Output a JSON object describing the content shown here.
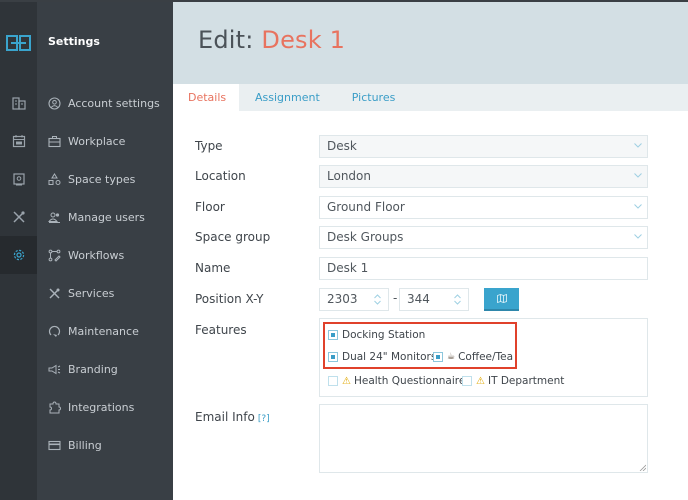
{
  "sidebar": {
    "title": "Settings",
    "logo_icon": "app-logo-icon",
    "rail": [
      {
        "icon": "building-icon",
        "active": false
      },
      {
        "icon": "calendar-icon",
        "active": false
      },
      {
        "icon": "badge-icon",
        "active": false
      },
      {
        "icon": "tools-icon",
        "active": false
      },
      {
        "icon": "gear-icon",
        "active": true
      }
    ],
    "items": [
      {
        "label": "Account settings",
        "icon": "user-circle-icon"
      },
      {
        "label": "Workplace",
        "icon": "briefcase-icon"
      },
      {
        "label": "Space types",
        "icon": "shapes-icon"
      },
      {
        "label": "Manage users",
        "icon": "users-icon"
      },
      {
        "label": "Workflows",
        "icon": "workflow-icon"
      },
      {
        "label": "Services",
        "icon": "tools-icon"
      },
      {
        "label": "Maintenance",
        "icon": "maintenance-icon"
      },
      {
        "label": "Branding",
        "icon": "megaphone-icon"
      },
      {
        "label": "Integrations",
        "icon": "puzzle-icon"
      },
      {
        "label": "Billing",
        "icon": "credit-card-icon"
      }
    ]
  },
  "header": {
    "prefix": "Edit:",
    "name": "Desk 1"
  },
  "tabs": [
    {
      "label": "Details",
      "active": true
    },
    {
      "label": "Assignment",
      "active": false
    },
    {
      "label": "Pictures",
      "active": false
    }
  ],
  "form": {
    "type": {
      "label": "Type",
      "value": "Desk"
    },
    "location": {
      "label": "Location",
      "value": "London"
    },
    "floor": {
      "label": "Floor",
      "value": "Ground Floor"
    },
    "space_group": {
      "label": "Space group",
      "value": "Desk Groups"
    },
    "name": {
      "label": "Name",
      "value": "Desk 1"
    },
    "position": {
      "label": "Position X-Y",
      "x": "2303",
      "separator": "-",
      "y": "344",
      "map_button_icon": "map-icon"
    },
    "features": {
      "label": "Features",
      "items": [
        {
          "label": "Docking Station",
          "checked": true,
          "icon": null
        },
        {
          "label": "Dual 24\" Monitors",
          "checked": true,
          "icon": null
        },
        {
          "label": "Coffee/Tea",
          "checked": true,
          "icon": "coffee-icon"
        },
        {
          "label": "Health Questionnaire",
          "checked": false,
          "icon": "warning-icon"
        },
        {
          "label": "IT Department",
          "checked": false,
          "icon": "warning-icon"
        }
      ]
    },
    "email_info": {
      "label": "Email Info",
      "help": "[?]",
      "value": ""
    }
  },
  "colors": {
    "accent": "#3a9dc7",
    "title_highlight": "#e8735f",
    "annotation_box": "#e0412b",
    "sidebar_bg": "#393f45",
    "rail_bg": "#2f3439",
    "header_bg": "#d3dfe4"
  }
}
